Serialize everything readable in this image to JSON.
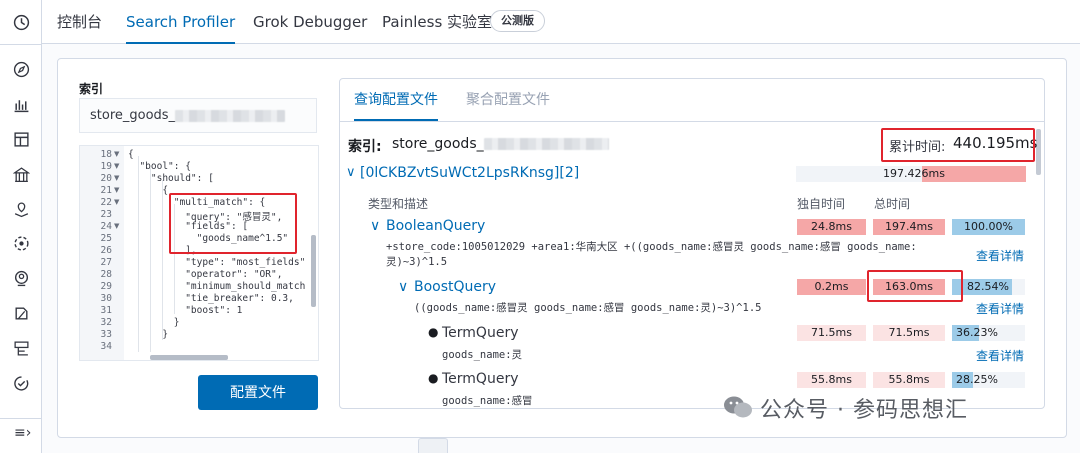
{
  "nav_tabs": {
    "console": "控制台",
    "search_profiler": "Search Profiler",
    "grok_debugger": "Grok Debugger",
    "painless_lab": "Painless 实验室",
    "beta_badge": "公测版"
  },
  "sidebar_icons": [
    "clock-icon",
    "compass-icon",
    "chart-icon",
    "dashboard-icon",
    "canvas-icon",
    "maps-icon",
    "ml-icon",
    "users-icon",
    "security-icon",
    "logs-icon",
    "uptime-icon"
  ],
  "left_panel": {
    "index_label": "索引",
    "index_value": "store_goods_",
    "config_button": "配置文件"
  },
  "editor": {
    "line_numbers": [
      "18",
      "19",
      "20",
      "21",
      "22",
      "23",
      "24",
      "25",
      "26",
      "27",
      "28",
      "29",
      "30",
      "31",
      "32",
      "33",
      "34"
    ],
    "lines": [
      "{",
      "  \"bool\": {",
      "    \"should\": [",
      "      {",
      "        \"multi_match\": {",
      "          \"query\": \"感冒灵\",",
      "          \"fields\": [",
      "            \"goods_name^1.5\"",
      "          ],",
      "          \"type\": \"most_fields\"",
      "          \"operator\": \"OR\",",
      "          \"minimum_should_match",
      "          \"tie_breaker\": 0.3,",
      "          \"boost\": 1",
      "        }",
      "      }",
      ""
    ]
  },
  "result_tabs": {
    "query_profile": "查询配置文件",
    "aggregation_profile": "聚合配置文件"
  },
  "result": {
    "index_label": "索引:",
    "index_value": "store_goods_",
    "cumulative_label": "累计时间:",
    "cumulative_value": "440.195ms",
    "shard": "[0lCKBZvtSuWCt2LpsRKnsg][2]",
    "shard_time": "197.426ms",
    "type_header": "类型和描述",
    "self_time_header": "独自时间",
    "total_time_header": "总时间",
    "view_details": "查看详情",
    "rows": [
      {
        "name": "BooleanQuery",
        "desc_line1": "+store_code:1005012029 +area1:华南大区 +((goods_name:感冒灵 goods_name:感冒 goods_name:",
        "desc_line2": "灵)~3)^1.5",
        "self": "24.8ms",
        "total": "197.4ms",
        "pct": "100.00%",
        "pct_value": 100.0
      },
      {
        "name": "BoostQuery",
        "desc_line1": "((goods_name:感冒灵 goods_name:感冒 goods_name:灵)~3)^1.5",
        "self": "0.2ms",
        "total": "163.0ms",
        "pct": "82.54%",
        "pct_value": 82.54
      },
      {
        "name": "TermQuery",
        "desc_line1": "goods_name:灵",
        "self": "71.5ms",
        "total": "71.5ms",
        "pct": "36.23%",
        "pct_value": 36.23
      },
      {
        "name": "TermQuery",
        "desc_line1": "goods_name:感冒",
        "self": "55.8ms",
        "total": "55.8ms",
        "pct": "28.25%",
        "pct_value": 28.25
      }
    ]
  },
  "watermark": "公众号 · 参码思想汇",
  "colors": {
    "accent": "#006bb4",
    "highlight": "#e0242d",
    "bar_pink": "#f5a7a7",
    "bar_blue": "#9ccbe8"
  }
}
